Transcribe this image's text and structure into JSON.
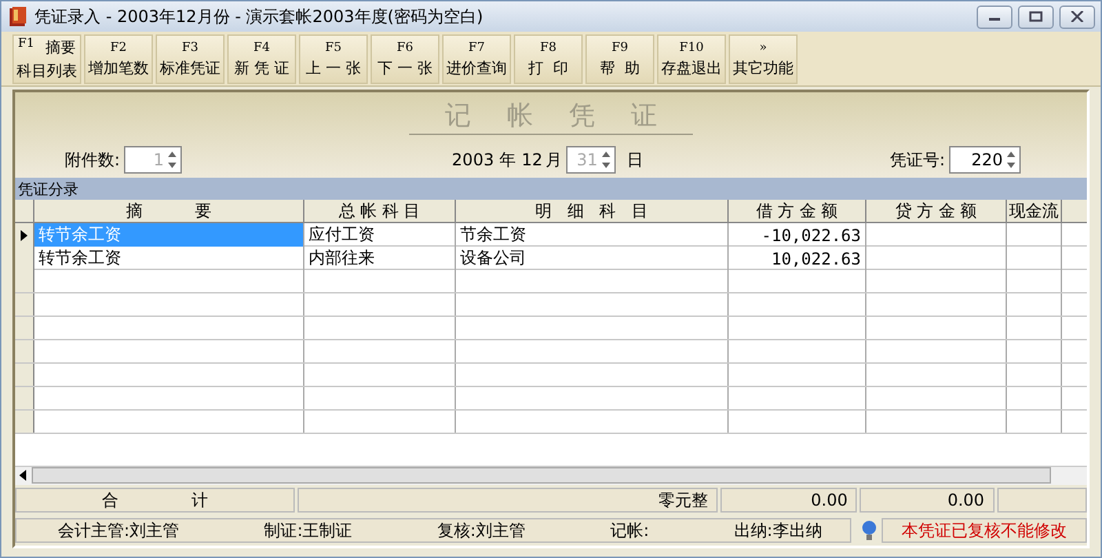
{
  "window": {
    "title": "凭证录入 - 2003年12月份 - 演示套帐2003年度(密码为空白)"
  },
  "toolbar": [
    {
      "key": "F1",
      "hint": "摘要",
      "label": "科目列表"
    },
    {
      "key": "F2",
      "label": "增加笔数"
    },
    {
      "key": "F3",
      "label": "标准凭证"
    },
    {
      "key": "F4",
      "label": "新 凭 证"
    },
    {
      "key": "F5",
      "label": "上 一 张"
    },
    {
      "key": "F6",
      "label": "下 一 张"
    },
    {
      "key": "F7",
      "label": "进价查询"
    },
    {
      "key": "F8",
      "label": "打  印"
    },
    {
      "key": "F9",
      "label": "帮  助"
    },
    {
      "key": "F10",
      "label": "存盘退出"
    },
    {
      "key": "»",
      "label": "其它功能"
    }
  ],
  "voucher": {
    "title": "记帐凭证",
    "attachments_label": "附件数:",
    "attachments": {
      "value": "1",
      "disabled": true
    },
    "year": "2003",
    "year_unit": "年",
    "month": "12",
    "month_unit": "月",
    "day": {
      "value": "31",
      "disabled": true
    },
    "day_unit": "日",
    "number_label": "凭证号:",
    "number": {
      "value": "220",
      "disabled": false
    }
  },
  "section_label": "凭证分录",
  "table": {
    "columns": [
      "摘          要",
      "总 帐 科 目",
      "明   细   科   目",
      "借 方 金 额",
      "贷 方 金 额",
      "现金流"
    ],
    "rows": [
      {
        "selected": true,
        "cells": [
          "转节余工资",
          "应付工资",
          "节余工资",
          "-10,022.63",
          "",
          ""
        ]
      },
      {
        "selected": false,
        "cells": [
          "转节余工资",
          "内部往来",
          "设备公司",
          "10,022.63",
          "",
          ""
        ]
      }
    ]
  },
  "totals": {
    "label": "合              计",
    "amount_words": "零元整",
    "debit": "0.00",
    "credit": "0.00"
  },
  "signatures": [
    "会计主管:刘主管",
    "制证:王制证",
    "复核:刘主管",
    "记帐:",
    "出纳:李出纳"
  ],
  "status": "本凭证已复核不能修改"
}
